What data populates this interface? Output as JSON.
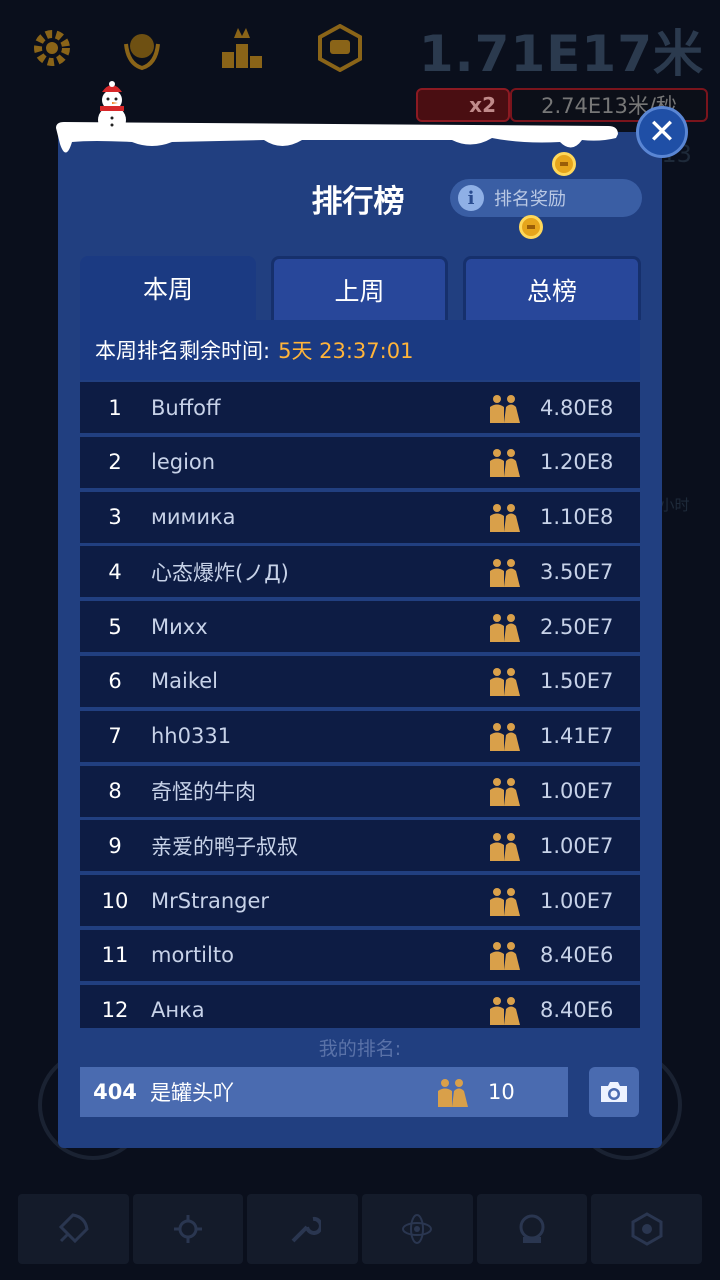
{
  "background": {
    "distance": "1.71E17米",
    "multiplier": "x2",
    "rate": "2.74E13米/秒",
    "side_timer": "9小时",
    "side_value": "0.0E13",
    "top_icons": [
      "gear-icon",
      "laurel-badge-icon",
      "podium-icon",
      "chat-badge-icon"
    ],
    "bottom_icons": [
      "rocket-icon",
      "satellite-icon",
      "wrench-icon",
      "atom-icon",
      "helmet-icon",
      "gear-badge-icon"
    ]
  },
  "modal": {
    "title": "排行榜",
    "reward_label": "排名奖励",
    "close_icon": "close-icon",
    "tabs": [
      {
        "label": "本周",
        "active": true
      },
      {
        "label": "上周",
        "active": false
      },
      {
        "label": "总榜",
        "active": false
      }
    ],
    "timer_label": "本周排名剩余时间:",
    "timer_value": "5天 23:37:01",
    "rows": [
      {
        "rank": "1",
        "name": "Buffoff",
        "score": "4.80E8"
      },
      {
        "rank": "2",
        "name": "legion",
        "score": "1.20E8"
      },
      {
        "rank": "3",
        "name": "мимика",
        "score": "1.10E8"
      },
      {
        "rank": "4",
        "name": "心态爆炸(ノД)",
        "score": "3.50E7"
      },
      {
        "rank": "5",
        "name": "Миxx",
        "score": "2.50E7"
      },
      {
        "rank": "6",
        "name": "Maikel",
        "score": "1.50E7"
      },
      {
        "rank": "7",
        "name": "hh0331",
        "score": "1.41E7"
      },
      {
        "rank": "8",
        "name": "奇怪的牛肉",
        "score": "1.00E7"
      },
      {
        "rank": "9",
        "name": "亲爱的鸭子叔叔",
        "score": "1.00E7"
      },
      {
        "rank": "10",
        "name": "MrStranger",
        "score": "1.00E7"
      },
      {
        "rank": "11",
        "name": "mortilto",
        "score": "8.40E6"
      },
      {
        "rank": "12",
        "name": "Анка",
        "score": "8.40E6"
      }
    ],
    "my_rank_label": "我的排名:",
    "my_row": {
      "rank": "404",
      "name": "是罐头吖",
      "score": "10"
    },
    "colors": {
      "accent": "#ffb43a",
      "panel": "#213f80",
      "row": "#0d1c44",
      "highlight": "#4a6bb0"
    }
  }
}
